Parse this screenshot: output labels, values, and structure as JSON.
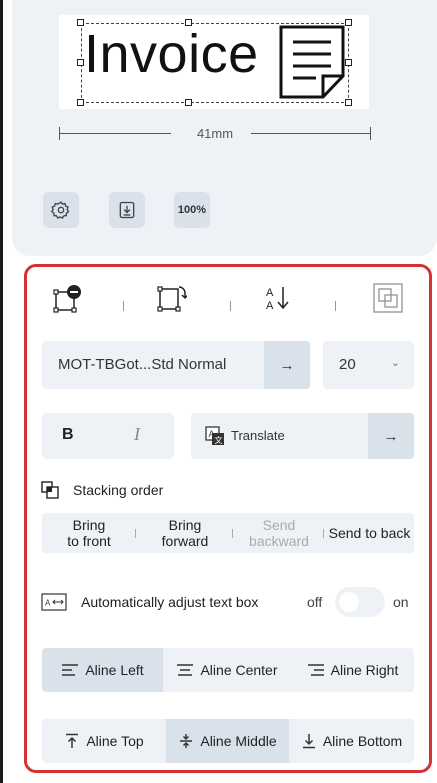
{
  "preview": {
    "label_text": "Invoice",
    "ruler_text": "41mm",
    "tools": {
      "settings_icon": "gear-icon",
      "export_icon": "download-icon",
      "zoom_label": "100%"
    }
  },
  "panel": {
    "top_icons": [
      "delete-element-icon",
      "rotate-icon",
      "text-direction-icon",
      "duplicate-icon"
    ],
    "font": {
      "name": "MOT-TBGot...Std Normal",
      "arrow": "→",
      "size": "20",
      "size_chevron": "⌄"
    },
    "style": {
      "bold": "B",
      "italic": "I",
      "translate": "Translate",
      "translate_arrow": "→"
    },
    "stacking": {
      "title": "Stacking order",
      "bring_front_line1": "Bring",
      "bring_front_line2": "to front",
      "bring_forward_line1": "Bring",
      "bring_forward_line2": "forward",
      "send_backward_line1": "Send",
      "send_backward_line2": "backward",
      "send_back": "Send to back"
    },
    "auto_adjust": {
      "label": "Automatically adjust text box",
      "off": "off",
      "on": "on",
      "state": "off"
    },
    "horizontal_align": {
      "left": "Aline Left",
      "center": "Aline Center",
      "right": "Aline Right",
      "active": "left"
    },
    "vertical_align": {
      "top": "Aline Top",
      "middle": "Aline Middle",
      "bottom": "Aline Bottom",
      "active": "middle"
    }
  },
  "colors": {
    "highlight_border": "#d23434",
    "control_bg": "#eef2f6",
    "active_bg": "#d9e2ea"
  }
}
